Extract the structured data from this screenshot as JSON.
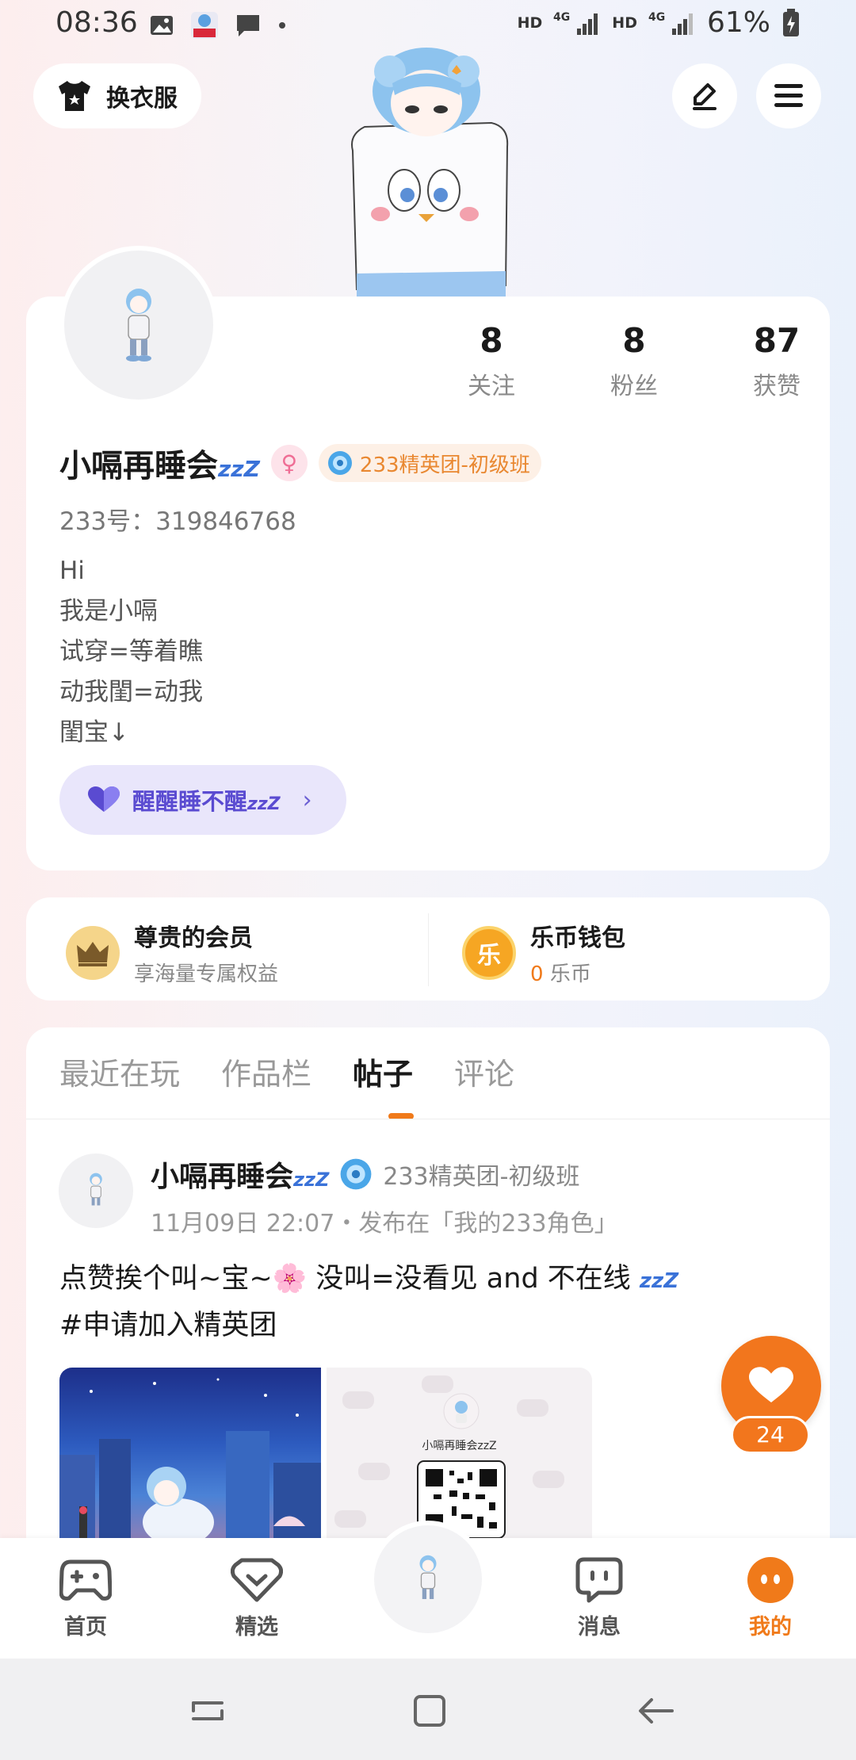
{
  "status_bar": {
    "time": "08:36",
    "network_1": "HD",
    "network_2": "HD",
    "signal_label": "4G",
    "battery": "61%"
  },
  "header": {
    "outfit_button": "换衣服",
    "icons": [
      "tshirt-icon",
      "edit-icon",
      "menu-icon"
    ]
  },
  "profile": {
    "stats": [
      {
        "value": "8",
        "label": "关注"
      },
      {
        "value": "8",
        "label": "粉丝"
      },
      {
        "value": "87",
        "label": "获赞"
      }
    ],
    "name": "小嗝再睡会",
    "name_suffix": "zzZ",
    "elite_badge": "233精英团-初级班",
    "uid": "233号：319846768",
    "bio_lines": [
      "Hi",
      "我是小嗝",
      "试穿=等着瞧",
      "动我閨=动我",
      "閨宝↓"
    ],
    "status_chip": "醒醒睡不醒",
    "status_suffix": "zzZ",
    "status_chevron": "›"
  },
  "membership": {
    "member_title": "尊贵的会员",
    "member_sub": "享海量专属权益",
    "wallet_title": "乐币钱包",
    "wallet_amount": "0",
    "wallet_unit": "乐币",
    "coin_glyph": "乐"
  },
  "tabs": [
    {
      "label": "最近在玩",
      "active": false
    },
    {
      "label": "作品栏",
      "active": false
    },
    {
      "label": "帖子",
      "active": true
    },
    {
      "label": "评论",
      "active": false
    }
  ],
  "post": {
    "author": "小嗝再睡会",
    "author_suffix": "zzZ",
    "elite_badge": "233精英团-初级班",
    "meta": "11月09日 22:07・发布在「我的233角色」",
    "text_line1": "点赞挨个叫~宝~🌸 没叫=没看见 and 不在线 ",
    "text_suffix": "zzZ",
    "text_line2": "#申请加入精英团",
    "qr_caption": "小嗝再睡会zzZ",
    "like_count": "24"
  },
  "bottom_nav": [
    {
      "label": "首页",
      "icon": "gamepad-icon",
      "active": false
    },
    {
      "label": "精选",
      "icon": "heart-diamond-icon",
      "active": false
    },
    {
      "label": "消息",
      "icon": "chat-icon",
      "active": false
    },
    {
      "label": "我的",
      "icon": "face-icon",
      "active": true
    }
  ],
  "colors": {
    "accent": "#f07a1a",
    "status_chip_bg": "#e9e6fb",
    "status_chip_text": "#5a4bd1",
    "elite_text": "#e98831"
  }
}
